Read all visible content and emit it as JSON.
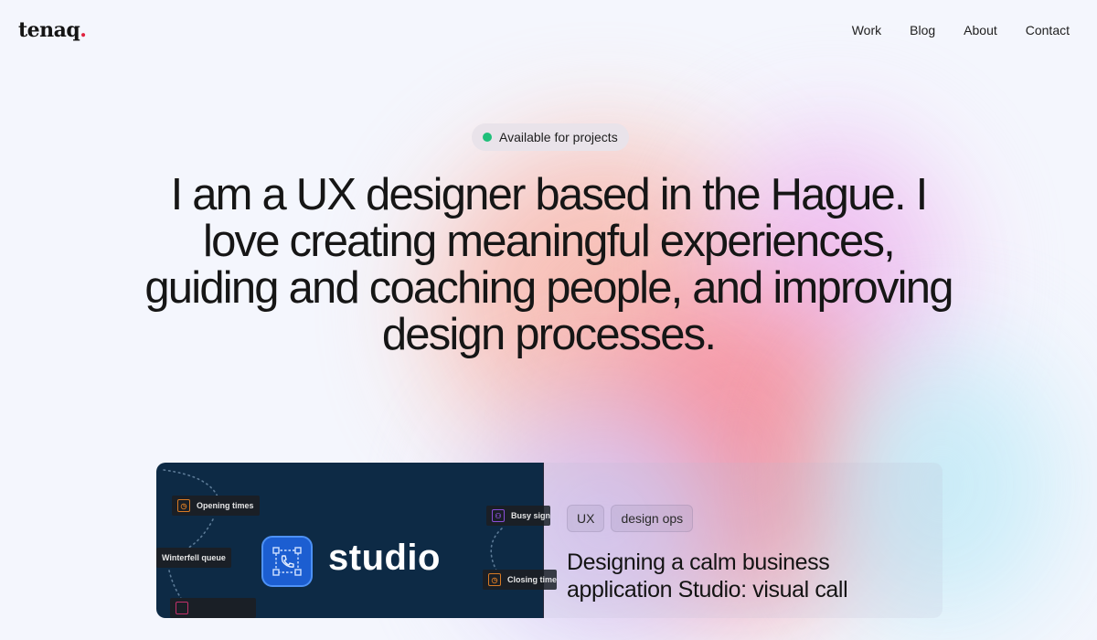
{
  "header": {
    "logo_text": "tenaq",
    "logo_dot": ".",
    "nav": [
      {
        "label": "Work"
      },
      {
        "label": "Blog"
      },
      {
        "label": "About"
      },
      {
        "label": "Contact"
      }
    ]
  },
  "hero": {
    "badge": {
      "label": "Available for projects",
      "status_color": "#1fbf7a"
    },
    "headline": "I am a UX designer based in the Hague. I love creating meaningful experiences, guiding and coaching people, and improving design processes."
  },
  "featured_case": {
    "image": {
      "app_name": "studio",
      "app_icon": "phone-call-icon",
      "nodes": [
        {
          "label": "Opening times",
          "icon": "clock-icon"
        },
        {
          "label": "Winterfell queue",
          "icon": ""
        },
        {
          "label": "Busy sign",
          "icon": "user-group-icon"
        },
        {
          "label": "Closing time",
          "icon": "clock-icon"
        }
      ]
    },
    "tags": [
      "UX",
      "design ops"
    ],
    "title": "Designing a calm business application Studio: visual call"
  }
}
